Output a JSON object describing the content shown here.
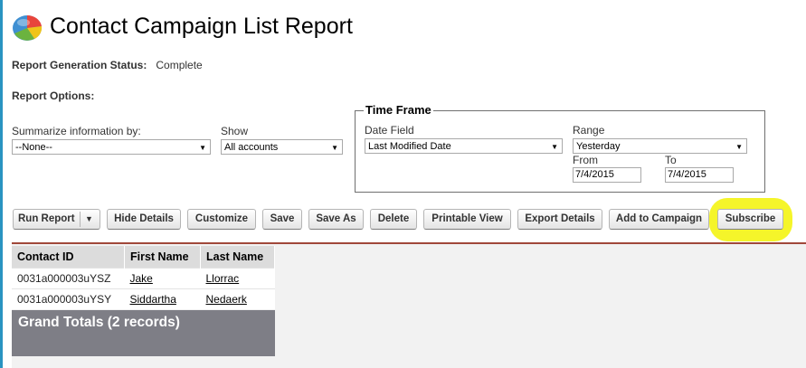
{
  "page": {
    "title": "Contact Campaign List Report"
  },
  "status": {
    "label": "Report Generation Status:",
    "value": "Complete"
  },
  "options": {
    "heading": "Report Options:",
    "summarize": {
      "label": "Summarize information by:",
      "value": "--None--"
    },
    "show": {
      "label": "Show",
      "value": "All accounts"
    }
  },
  "time_frame": {
    "legend": "Time Frame",
    "date_field": {
      "label": "Date Field",
      "value": "Last Modified Date"
    },
    "range": {
      "label": "Range",
      "value": "Yesterday"
    },
    "from": {
      "label": "From",
      "value": "7/4/2015"
    },
    "to": {
      "label": "To",
      "value": "7/4/2015"
    }
  },
  "toolbar": {
    "run_report": "Run Report",
    "hide_details": "Hide Details",
    "customize": "Customize",
    "save": "Save",
    "save_as": "Save As",
    "delete": "Delete",
    "printable_view": "Printable View",
    "export_details": "Export Details",
    "add_to_campaign": "Add to Campaign",
    "subscribe": "Subscribe"
  },
  "table": {
    "columns": [
      "Contact ID",
      "First Name",
      "Last Name"
    ],
    "rows": [
      [
        "0031a000003uYSZ",
        "Jake",
        "Llorrac"
      ],
      [
        "0031a000003uYSY",
        "Siddartha",
        "Nedaerk"
      ]
    ],
    "grand_totals": "Grand Totals (2 records)"
  },
  "colors": {
    "highlight": "#f5f52a",
    "accent_rule": "#a0483a",
    "left_rule": "#2a94c1"
  },
  "icons": {
    "report": "report-chart-icon",
    "dropdown": "chevron-down-icon"
  }
}
